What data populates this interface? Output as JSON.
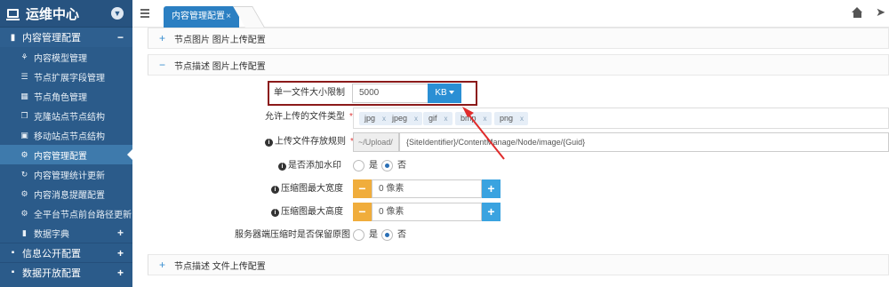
{
  "sidebar": {
    "title": "运维中心",
    "groups": [
      {
        "label": "内容管理配置",
        "toggle": "−"
      },
      {
        "label": "信息公开配置",
        "toggle": "+"
      },
      {
        "label": "数据开放配置",
        "toggle": "+"
      }
    ],
    "items": [
      {
        "label": "内容模型管理",
        "icon": "sitemap-icon"
      },
      {
        "label": "节点扩展字段管理",
        "icon": "list-icon"
      },
      {
        "label": "节点角色管理",
        "icon": "table-icon"
      },
      {
        "label": "克隆站点节点结构",
        "icon": "clone-icon"
      },
      {
        "label": "移动站点节点结构",
        "icon": "move-icon"
      },
      {
        "label": "内容管理配置",
        "icon": "gear-icon"
      },
      {
        "label": "内容管理统计更新",
        "icon": "refresh-icon"
      },
      {
        "label": "内容消息提醒配置",
        "icon": "bell-icon"
      },
      {
        "label": "全平台节点前台路径更新",
        "icon": "gear-icon"
      },
      {
        "label": "数据字典",
        "icon": "book-icon",
        "toggle": "+"
      }
    ]
  },
  "tabs": [
    {
      "label": "内容管理配置",
      "close": "×"
    }
  ],
  "panels": [
    {
      "label": "节点图片 图片上传配置",
      "toggle": "+"
    },
    {
      "label": "节点描述 图片上传配置",
      "toggle": "−"
    },
    {
      "label": "节点描述 文件上传配置",
      "toggle": "+"
    }
  ],
  "form": {
    "max_size": {
      "label": "单一文件大小限制",
      "value": "5000",
      "unit": "KB"
    },
    "types": {
      "label": "允许上传的文件类型",
      "required": "*",
      "tags": [
        "jpg",
        "jpeg",
        "gif",
        "bmp",
        "png"
      ],
      "remove": "x"
    },
    "path": {
      "label": "上传文件存放规则",
      "required": "*",
      "prefix": "~/Upload/",
      "value": "{SiteIdentifier}/ContentManage/Node/image/{Guid}"
    },
    "watermark": {
      "label": "是否添加水印",
      "yes": "是",
      "no": "否",
      "selected": "否"
    },
    "max_width": {
      "label": "压缩图最大宽度",
      "placeholder": "0 像素",
      "minus": "−",
      "plus": "+"
    },
    "max_height": {
      "label": "压缩图最大高度",
      "placeholder": "0 像素",
      "minus": "−",
      "plus": "+"
    },
    "keep_original": {
      "label": "服务器端压缩时是否保留原图",
      "yes": "是",
      "no": "否",
      "selected": "否"
    }
  },
  "colors": {
    "sidebar": "#2b5b8a",
    "accent": "#2b7fc2",
    "highlight": "#8b1a1a",
    "arrow": "#e02b2b"
  }
}
